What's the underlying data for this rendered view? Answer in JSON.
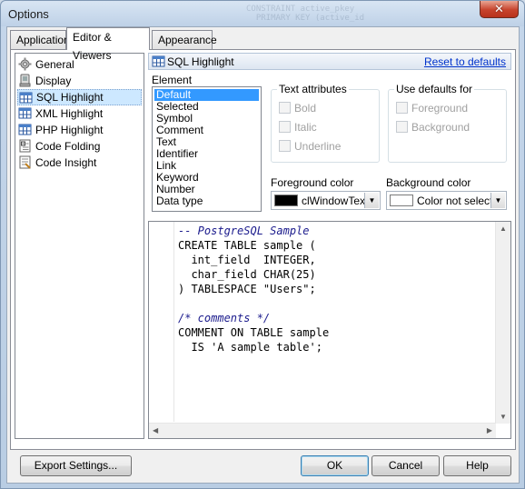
{
  "window": {
    "title": "Options",
    "close_glyph": "✕",
    "background_ghost_text": "CONSTRAINT active_pkey\n  PRIMARY KEY (active_id"
  },
  "tabs": [
    {
      "label": "Application",
      "active": false
    },
    {
      "label": "Editor & Viewers",
      "active": true
    },
    {
      "label": "Appearance",
      "active": false
    }
  ],
  "nav": {
    "items": [
      {
        "label": "General",
        "icon": "gear-icon",
        "selected": false
      },
      {
        "label": "Display",
        "icon": "display-icon",
        "selected": false
      },
      {
        "label": "SQL Highlight",
        "icon": "grid-icon",
        "selected": true
      },
      {
        "label": "XML Highlight",
        "icon": "grid-icon",
        "selected": false
      },
      {
        "label": "PHP Highlight",
        "icon": "grid-icon",
        "selected": false
      },
      {
        "label": "Code Folding",
        "icon": "code-folding-icon",
        "selected": false
      },
      {
        "label": "Code Insight",
        "icon": "code-insight-icon",
        "selected": false
      }
    ]
  },
  "panel": {
    "title": "SQL Highlight",
    "reset_link": "Reset to defaults"
  },
  "element": {
    "label": "Element",
    "items": [
      "Default",
      "Selected",
      "Symbol",
      "Comment",
      "Text",
      "Identifier",
      "Link",
      "Keyword",
      "Number",
      "Data type"
    ],
    "selected_index": 0
  },
  "text_attributes": {
    "title": "Text attributes",
    "bold": "Bold",
    "italic": "Italic",
    "underline": "Underline"
  },
  "use_defaults": {
    "title": "Use defaults for",
    "foreground": "Foreground",
    "background": "Background"
  },
  "foreground_color": {
    "label": "Foreground color",
    "value": "clWindowText",
    "swatch": "#000000"
  },
  "background_color": {
    "label": "Background color",
    "value": "Color not selected",
    "swatch": "#ffffff"
  },
  "preview": {
    "lines": [
      {
        "text": "-- PostgreSQL Sample",
        "kind": "comment"
      },
      {
        "text": "CREATE TABLE sample (",
        "kind": "code"
      },
      {
        "text": "  int_field  INTEGER,",
        "kind": "code"
      },
      {
        "text": "  char_field CHAR(25)",
        "kind": "code"
      },
      {
        "text": ") TABLESPACE \"Users\";",
        "kind": "code"
      },
      {
        "text": "",
        "kind": "code"
      },
      {
        "text": "/* comments */",
        "kind": "comment"
      },
      {
        "text": "COMMENT ON TABLE sample",
        "kind": "code"
      },
      {
        "text": "  IS 'A sample table';",
        "kind": "code"
      }
    ]
  },
  "buttons": {
    "export": "Export Settings...",
    "ok": "OK",
    "cancel": "Cancel",
    "help": "Help"
  },
  "colors": {
    "accent_selection": "#3399ff",
    "link": "#0033cc",
    "comment": "#1a1a8c"
  }
}
